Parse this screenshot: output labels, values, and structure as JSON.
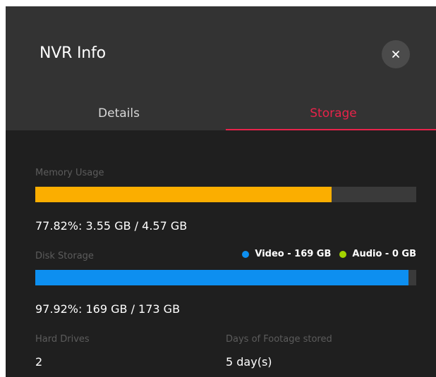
{
  "dialog": {
    "title": "NVR Info",
    "close_icon": "×"
  },
  "tabs": [
    {
      "label": "Details",
      "active": false
    },
    {
      "label": "Storage",
      "active": true
    }
  ],
  "memory": {
    "label": "Memory Usage",
    "summary": "77.82%: 3.55 GB / 4.57 GB",
    "percent": 77.82,
    "color": "#fbae00"
  },
  "disk": {
    "label": "Disk Storage",
    "summary": "97.92%: 169 GB / 173 GB",
    "percent": 97.92,
    "color": "#0d8ff0",
    "legend": [
      {
        "label": "Video - 169 GB",
        "color": "#0d8ff0"
      },
      {
        "label": "Audio - 0 GB",
        "color": "#a4d400"
      }
    ]
  },
  "hard_drives": {
    "label": "Hard Drives",
    "value": "2"
  },
  "footage": {
    "label": "Days of Footage stored",
    "value": "5 day(s)"
  },
  "colors": {
    "accent": "#e8234a",
    "background": "#1f1f1f",
    "header": "#333333"
  }
}
